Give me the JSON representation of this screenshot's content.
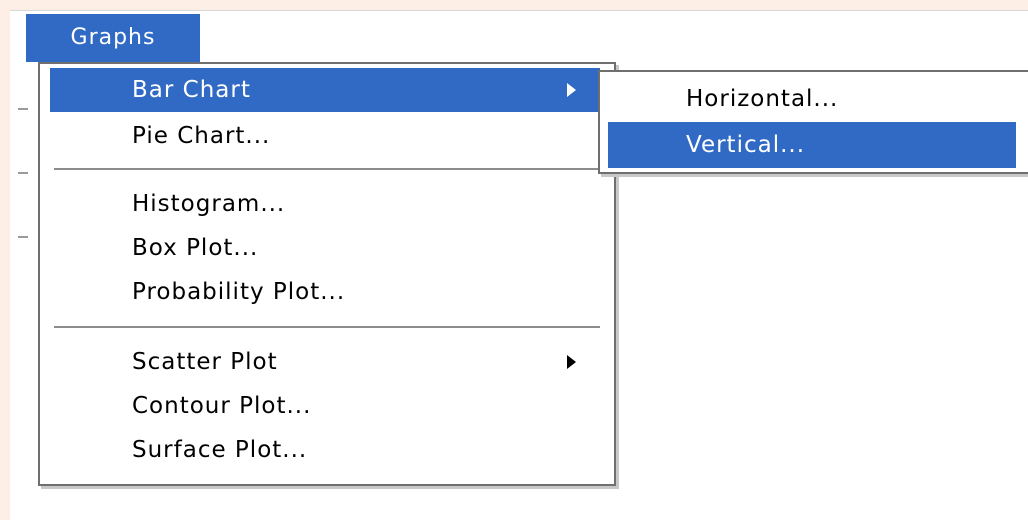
{
  "menubar": {
    "title": "Graphs"
  },
  "graphs_menu": {
    "items": [
      {
        "label": "Bar Chart",
        "has_submenu": true,
        "selected": true
      },
      {
        "label": "Pie Chart...",
        "has_submenu": false,
        "selected": false
      },
      {
        "label": "Histogram...",
        "has_submenu": false,
        "selected": false
      },
      {
        "label": "Box Plot...",
        "has_submenu": false,
        "selected": false
      },
      {
        "label": "Probability Plot...",
        "has_submenu": false,
        "selected": false
      },
      {
        "label": "Scatter Plot",
        "has_submenu": true,
        "selected": false
      },
      {
        "label": "Contour Plot...",
        "has_submenu": false,
        "selected": false
      },
      {
        "label": "Surface Plot...",
        "has_submenu": false,
        "selected": false
      }
    ]
  },
  "bar_chart_submenu": {
    "items": [
      {
        "label": "Horizontal...",
        "selected": false
      },
      {
        "label": "Vertical...",
        "selected": true
      }
    ]
  },
  "colors": {
    "highlight": "#316ac5",
    "page_background": "#fdeee6",
    "menu_border": "#6f6f6f"
  }
}
